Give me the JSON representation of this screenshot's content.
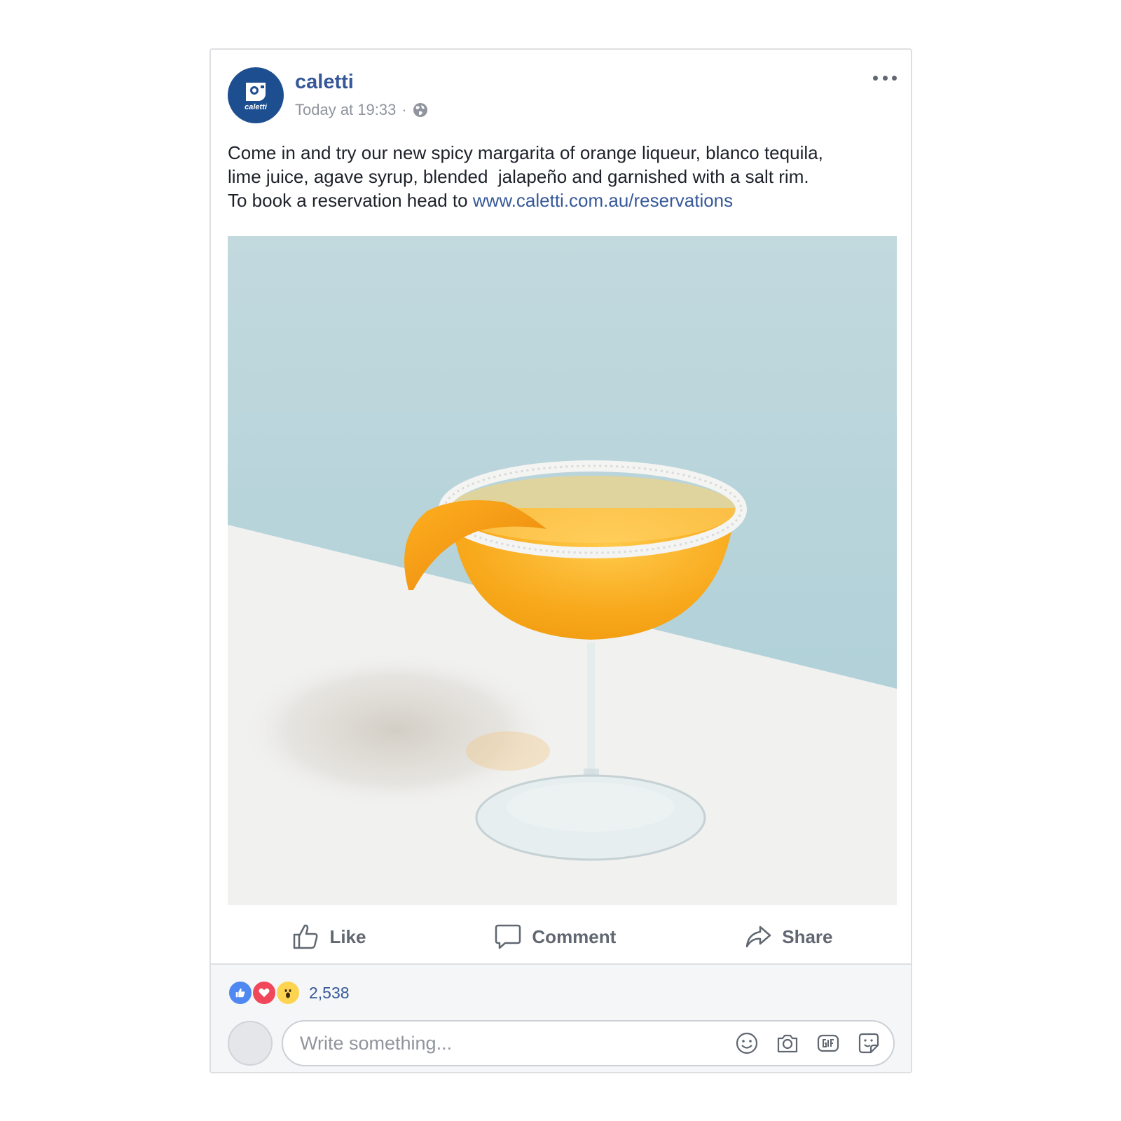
{
  "post": {
    "page_name": "caletti",
    "avatar_brand": "caletti",
    "timestamp": "Today at 19:33",
    "separator": "·",
    "visibility_icon": "globe-icon",
    "more_icon": "more-options-icon",
    "text_line_1": "Come in and try our new spicy margarita of orange liqueur, blanco tequila,",
    "text_line_2": "lime juice, agave syrup, blended  jalapeño and garnished with a salt rim.",
    "text_line_3_prefix": "To book a reservation head to ",
    "link_text": "www.caletti.com.au/reservations",
    "photo_subject": "margarita-in-coupe-glass"
  },
  "actions": {
    "like_label": "Like",
    "comment_label": "Comment",
    "share_label": "Share"
  },
  "reactions": {
    "icons": [
      "like-reaction-icon",
      "love-reaction-icon",
      "wow-reaction-icon"
    ],
    "count": "2,538"
  },
  "composer": {
    "placeholder": "Write something...",
    "value": "",
    "tools": [
      "emoji-icon",
      "camera-icon",
      "gif-icon",
      "sticker-icon"
    ]
  },
  "colors": {
    "brand_blue": "#365899",
    "avatar_blue": "#1d4e8f",
    "muted_text": "#90949c",
    "action_text": "#606770",
    "like_blue": "#4e88f0",
    "love_red": "#f0475b",
    "wow_yellow": "#fcd450"
  }
}
